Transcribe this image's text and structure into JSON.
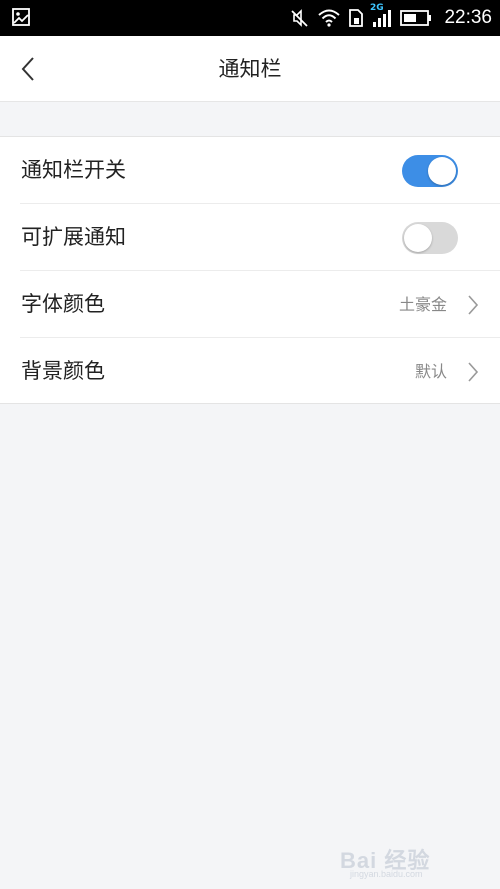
{
  "status_bar": {
    "network_type": "2G",
    "time": "22:36",
    "icons": [
      "image-icon",
      "mute-icon",
      "wifi-icon",
      "sim-icon",
      "signal-icon",
      "battery-icon"
    ]
  },
  "header": {
    "title": "通知栏",
    "back_icon": "chevron-left-icon"
  },
  "settings": {
    "rows": [
      {
        "label": "通知栏开关",
        "type": "toggle",
        "on": true
      },
      {
        "label": "可扩展通知",
        "type": "toggle",
        "on": false
      },
      {
        "label": "字体颜色",
        "type": "nav",
        "value": "土豪金"
      },
      {
        "label": "背景颜色",
        "type": "nav",
        "value": "默认"
      }
    ]
  },
  "watermark": {
    "text": "Bai 经验",
    "url": "jingyan.baidu.com"
  },
  "colors": {
    "accent": "#3d8ee6",
    "toggle_off": "#d9d9d9",
    "background": "#f4f5f7",
    "status_bar": "#000000"
  }
}
